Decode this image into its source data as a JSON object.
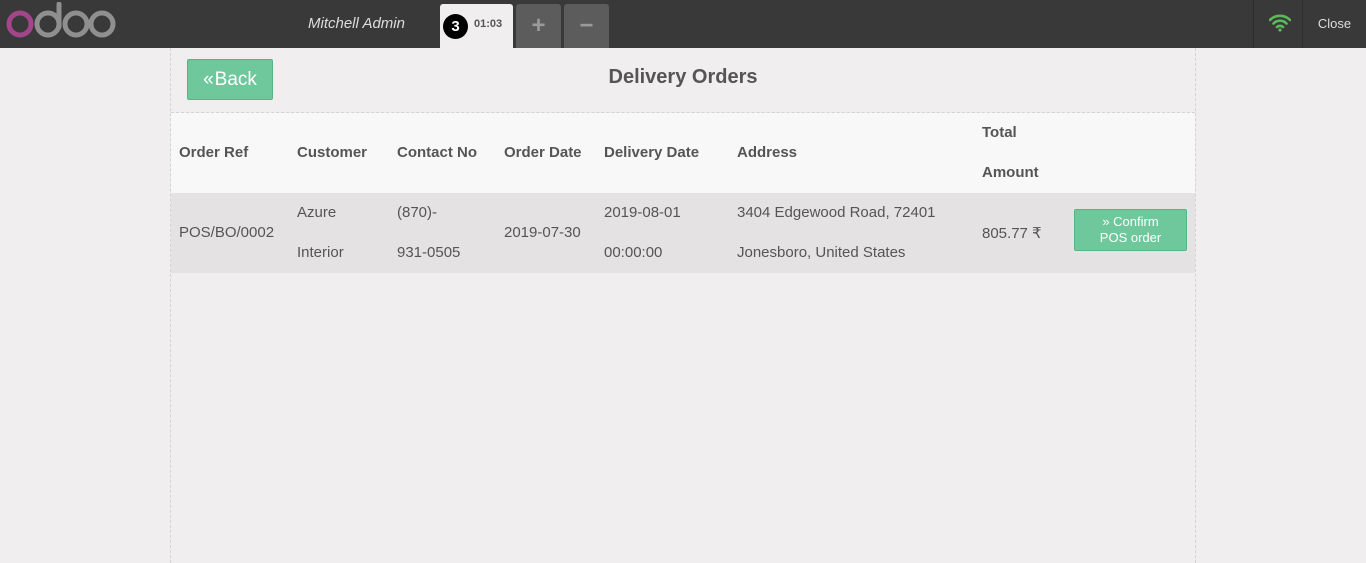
{
  "topbar": {
    "brand": "odoo",
    "user": "Mitchell Admin",
    "order_tab": {
      "sequence": "3",
      "time": "01:03"
    },
    "add_label": "+",
    "remove_label": "−",
    "close_label": "Close",
    "icons": [
      "wifi-icon"
    ],
    "colors": {
      "wifi": "#5cb85c",
      "logo_o": "#a24689",
      "logo_rest": "#8f8f8f"
    }
  },
  "screen": {
    "back_label": "Back",
    "title": "Delivery Orders",
    "columns": {
      "order_ref": "Order Ref",
      "customer": "Customer",
      "contact": "Contact No",
      "order_date": "Order Date",
      "delivery_date": "Delivery Date",
      "address": "Address",
      "total_line1": "Total",
      "total_line2": "Amount"
    },
    "orders": [
      {
        "ref": "POS/BO/0002",
        "customer_line1": "Azure",
        "customer_line2": "Interior",
        "contact_line1": "(870)-",
        "contact_line2": "931-0505",
        "order_date": "2019-07-30",
        "delivery_date_line1": "2019-08-01",
        "delivery_date_line2": "00:00:00",
        "address_line1": "3404 Edgewood Road, 72401",
        "address_line2": "Jonesboro, United States",
        "total": "805.77 ₹",
        "confirm_line1": "Confirm",
        "confirm_line2": "POS order"
      }
    ],
    "accent_color": "#6ec89b"
  }
}
